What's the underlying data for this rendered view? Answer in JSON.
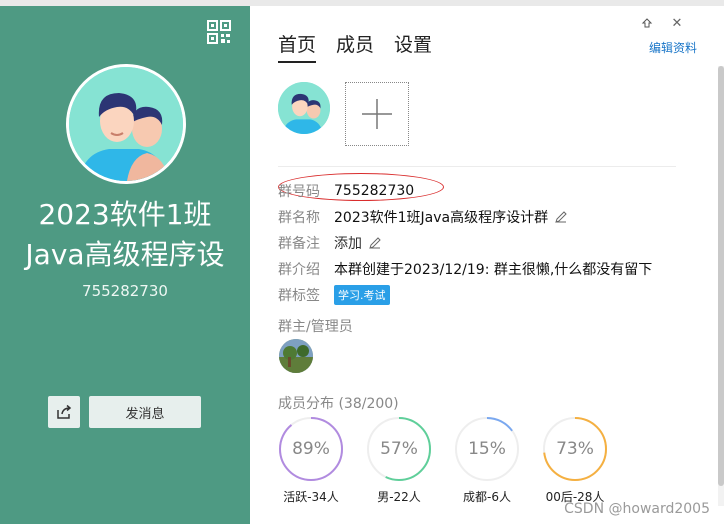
{
  "left": {
    "title_line1": "2023软件1班",
    "title_line2": "Java高级程序设",
    "group_number": "755282730",
    "send_button": "发消息"
  },
  "tabs": [
    {
      "label": "首页",
      "active": true
    },
    {
      "label": "成员",
      "active": false
    },
    {
      "label": "设置",
      "active": false
    }
  ],
  "edit_link": "编辑资料",
  "info": {
    "id_label": "群号码",
    "id_value": "755282730",
    "name_label": "群名称",
    "name_value": "2023软件1班Java高级程序设计群",
    "remark_label": "群备注",
    "remark_value": "添加",
    "intro_label": "群介绍",
    "intro_value": "本群创建于2023/12/19:  群主很懒,什么都没有留下",
    "tag_label": "群标签",
    "tag_value": "学习.考试"
  },
  "admins_label": "群主/管理员",
  "distribution_label": "成员分布 (38/200)",
  "stats": [
    {
      "percent": "89%",
      "value": 89,
      "label": "活跃-34人",
      "color": "#b18be0"
    },
    {
      "percent": "57%",
      "value": 57,
      "label": "男-22人",
      "color": "#5fcf9a"
    },
    {
      "percent": "15%",
      "value": 15,
      "label": "成都-6人",
      "color": "#7aa8f0"
    },
    {
      "percent": "73%",
      "value": 73,
      "label": "00后-28人",
      "color": "#f5b041"
    }
  ],
  "watermark": "CSDN @howard2005",
  "colors": {
    "left_bg": "#4e9a83",
    "link": "#1a76c8",
    "tag_bg": "#2a9fe7",
    "oval": "#d92c2c"
  },
  "icons": [
    "qr-code-icon",
    "pin-icon",
    "close-icon",
    "share-icon",
    "plus-icon",
    "pencil-icon"
  ]
}
